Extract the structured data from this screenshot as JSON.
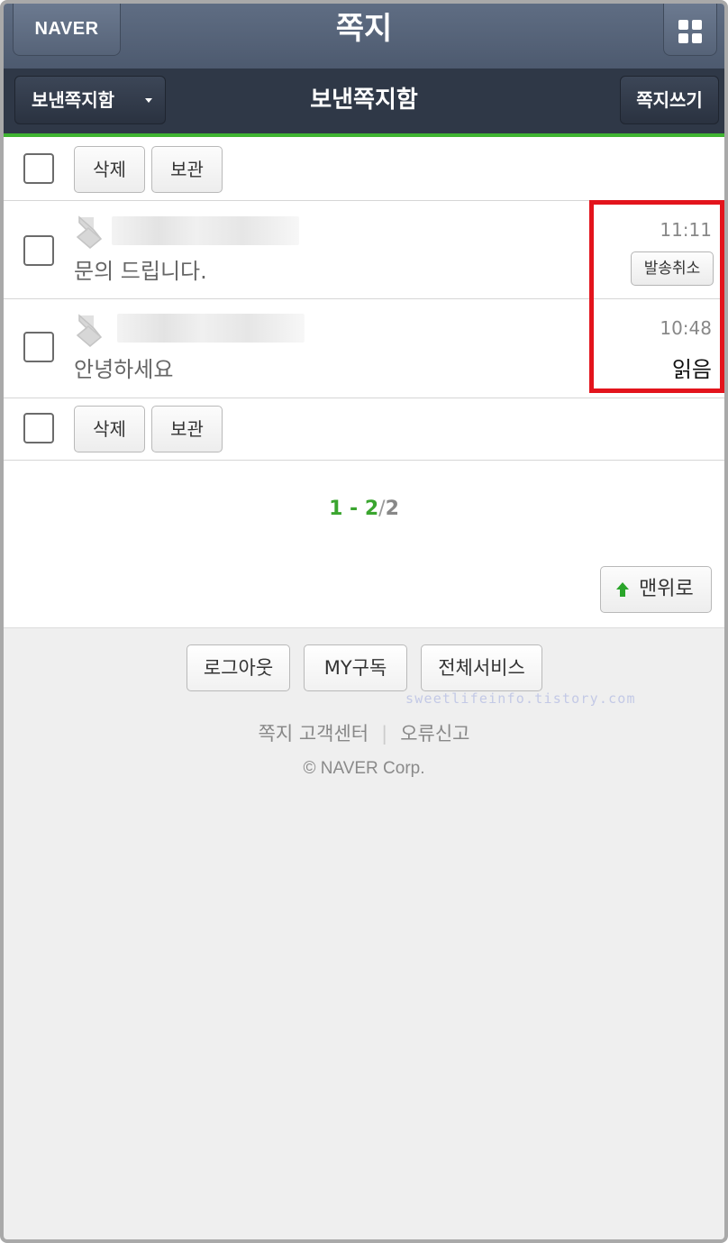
{
  "header": {
    "logo": "NAVER",
    "title": "쪽지"
  },
  "subheader": {
    "folder_label": "보낸쪽지함",
    "title": "보낸쪽지함",
    "write_label": "쪽지쓰기"
  },
  "actions": {
    "delete_label": "삭제",
    "archive_label": "보관"
  },
  "messages": [
    {
      "subject": "문의 드립니다.",
      "time": "11:11",
      "action_label": "발송취소"
    },
    {
      "subject": "안녕하세요",
      "time": "10:48",
      "status": "읽음"
    }
  ],
  "pagination": {
    "range": "1 - 2",
    "separator": "/",
    "total": "2"
  },
  "top_button_label": "맨위로",
  "footer": {
    "buttons": [
      "로그아웃",
      "MY구독",
      "전체서비스"
    ],
    "watermark": "sweetlifeinfo.tistory.com",
    "links": [
      "쪽지 고객센터",
      "오류신고"
    ],
    "link_separator": "|",
    "copyright": "© NAVER Corp."
  },
  "colors": {
    "accent_green": "#3fb431",
    "highlight_red": "#e3141c",
    "header_dark": "#2f3847"
  },
  "icons": {
    "apps": "grid-icon",
    "sender": "person-icon",
    "up": "arrow-up-icon",
    "folder": "caret-down-icon"
  }
}
